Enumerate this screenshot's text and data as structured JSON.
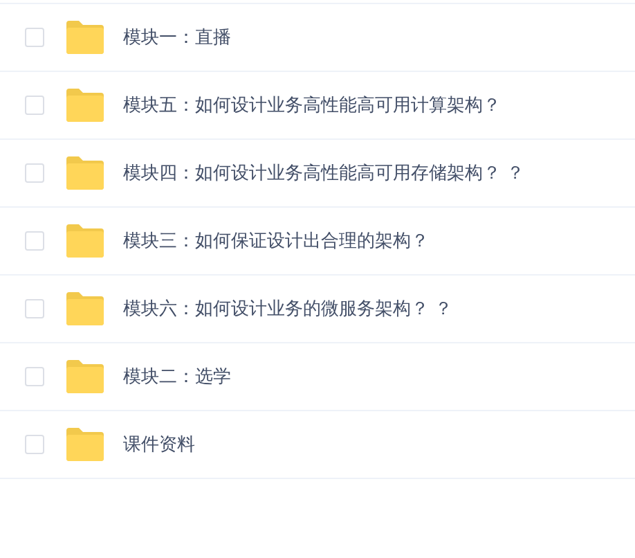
{
  "files": [
    {
      "name": "模块一：直播",
      "checked": false
    },
    {
      "name": "模块五：如何设计业务高性能高可用计算架构？",
      "checked": false
    },
    {
      "name": "模块四：如何设计业务高性能高可用存储架构？ ？",
      "checked": false
    },
    {
      "name": "模块三：如何保证设计出合理的架构？",
      "checked": false
    },
    {
      "name": "模块六：如何设计业务的微服务架构？ ？",
      "checked": false
    },
    {
      "name": "模块二：选学",
      "checked": false
    },
    {
      "name": "课件资料",
      "checked": false
    }
  ]
}
